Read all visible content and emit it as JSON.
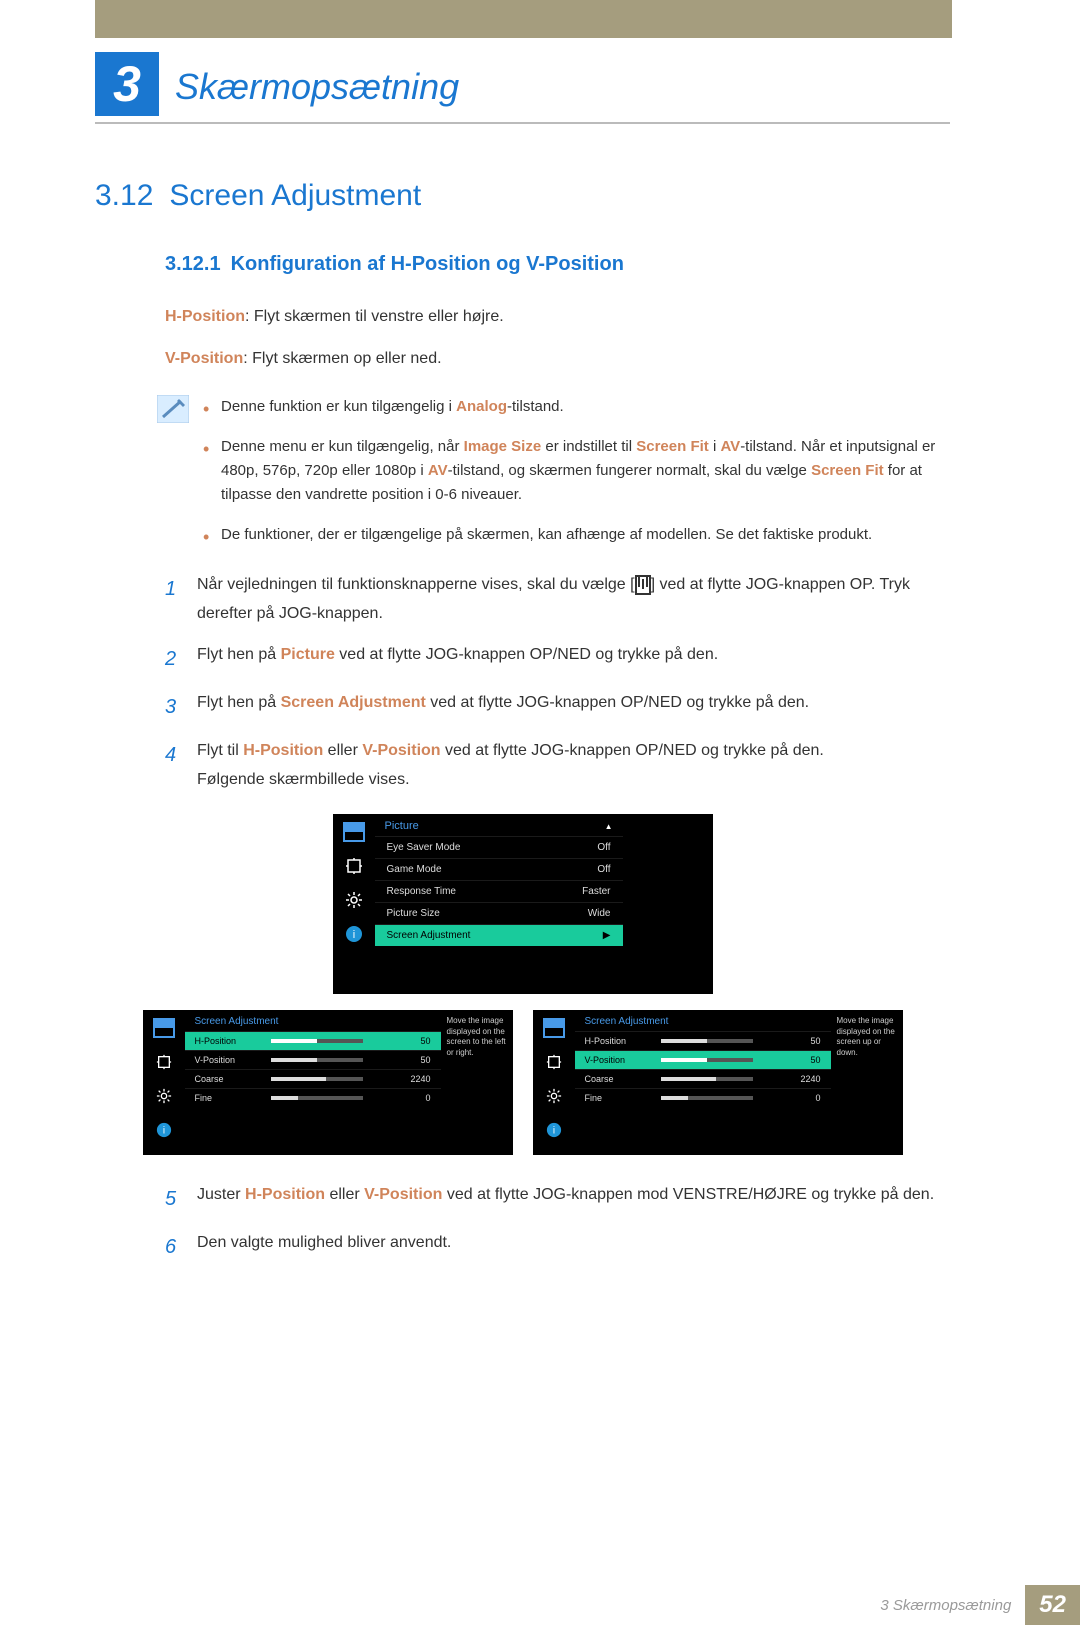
{
  "chapter": {
    "number": "3",
    "title": "Skærmopsætning"
  },
  "section": {
    "number": "3.12",
    "title": "Screen Adjustment"
  },
  "subsection": {
    "number": "3.12.1",
    "title": "Konfiguration af H-Position og V-Position"
  },
  "defs": {
    "h_label": "H-Position",
    "h_text": ": Flyt skærmen til venstre eller højre.",
    "v_label": "V-Position",
    "v_text": ": Flyt skærmen op eller ned."
  },
  "notes": {
    "n1_a": "Denne funktion er kun tilgængelig i ",
    "n1_hl": "Analog",
    "n1_b": "-tilstand.",
    "n2_a": "Denne menu er kun tilgængelig, når ",
    "n2_hl1": "Image Size",
    "n2_b": " er indstillet til ",
    "n2_hl2": "Screen Fit",
    "n2_c": " i ",
    "n2_hl3": "AV",
    "n2_d": "-tilstand. Når et inputsignal er 480p, 576p, 720p eller 1080p i ",
    "n2_hl4": "AV",
    "n2_e": "-tilstand, og skærmen fungerer normalt, skal du vælge ",
    "n2_hl5": "Screen Fit",
    "n2_f": " for at tilpasse den vandrette position i 0-6 niveauer.",
    "n3": "De funktioner, der er tilgængelige på skærmen, kan afhænge af modellen. Se det faktiske produkt."
  },
  "steps": {
    "s1a": "Når vejledningen til funktionsknapperne vises, skal du vælge [",
    "s1b": "] ved at flytte JOG-knappen OP. Tryk derefter på JOG-knappen.",
    "s2a": "Flyt hen på ",
    "s2hl": "Picture",
    "s2b": " ved at flytte JOG-knappen OP/NED og trykke på den.",
    "s3a": "Flyt hen på ",
    "s3hl": "Screen Adjustment",
    "s3b": " ved at flytte JOG-knappen OP/NED og trykke på den.",
    "s4a": "Flyt til ",
    "s4hl1": "H-Position",
    "s4mid": " eller ",
    "s4hl2": "V-Position",
    "s4b": " ved at flytte JOG-knappen OP/NED og trykke på den.",
    "s4c": "Følgende skærmbillede vises.",
    "s5a": "Juster ",
    "s5hl1": "H-Position",
    "s5mid": " eller ",
    "s5hl2": "V-Position",
    "s5b": " ved at flytte JOG-knappen mod VENSTRE/HØJRE og trykke på den.",
    "s6": "Den valgte mulighed bliver anvendt."
  },
  "osd1": {
    "title": "Picture",
    "rows": [
      {
        "label": "Eye Saver Mode",
        "value": "Off"
      },
      {
        "label": "Game Mode",
        "value": "Off"
      },
      {
        "label": "Response Time",
        "value": "Faster"
      },
      {
        "label": "Picture Size",
        "value": "Wide"
      },
      {
        "label": "Screen Adjustment",
        "value": "",
        "sel": true
      }
    ]
  },
  "osd2a": {
    "title": "Screen Adjustment",
    "desc": "Move the image displayed on the screen to the left or right.",
    "rows": [
      {
        "label": "H-Position",
        "value": "50",
        "fill": 50,
        "sel": true
      },
      {
        "label": "V-Position",
        "value": "50",
        "fill": 50
      },
      {
        "label": "Coarse",
        "value": "2240",
        "fill": 60
      },
      {
        "label": "Fine",
        "value": "0",
        "fill": 30
      }
    ]
  },
  "osd2b": {
    "title": "Screen Adjustment",
    "desc": "Move the image displayed on the screen up or down.",
    "rows": [
      {
        "label": "H-Position",
        "value": "50",
        "fill": 50
      },
      {
        "label": "V-Position",
        "value": "50",
        "fill": 50,
        "sel": true
      },
      {
        "label": "Coarse",
        "value": "2240",
        "fill": 60
      },
      {
        "label": "Fine",
        "value": "0",
        "fill": 30
      }
    ]
  },
  "footer": {
    "text": "3 Skærmopsætning",
    "page": "52"
  }
}
